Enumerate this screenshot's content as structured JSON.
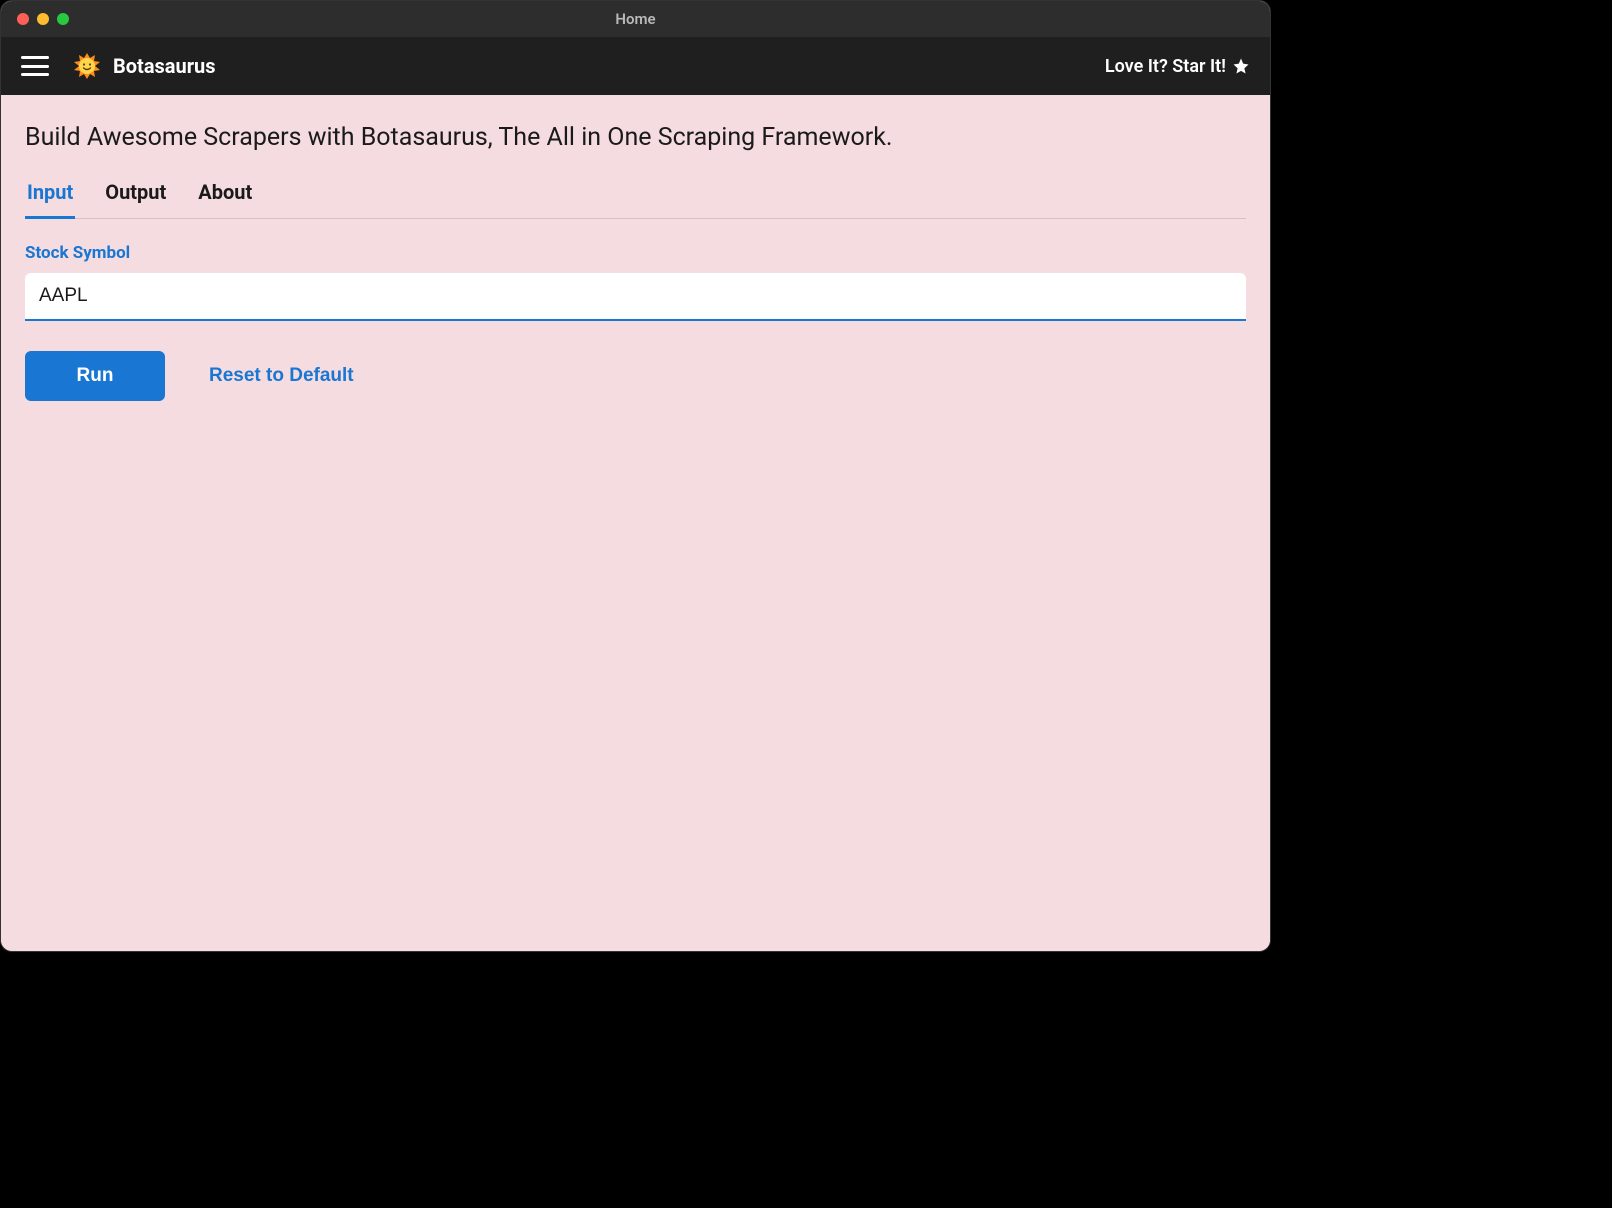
{
  "window": {
    "title": "Home"
  },
  "appbar": {
    "brand": "Botasaurus",
    "star_label": "Love It? Star It!"
  },
  "main": {
    "headline": "Build Awesome Scrapers with Botasaurus, The All in One Scraping Framework.",
    "tabs": [
      {
        "label": "Input",
        "active": true
      },
      {
        "label": "Output",
        "active": false
      },
      {
        "label": "About",
        "active": false
      }
    ],
    "form": {
      "stock_symbol_label": "Stock Symbol",
      "stock_symbol_value": "AAPL"
    },
    "actions": {
      "run_label": "Run",
      "reset_label": "Reset to Default"
    }
  },
  "colors": {
    "accent": "#1976d2",
    "app_bg": "#f5dce0",
    "appbar_bg": "#1f1f1f",
    "titlebar_bg": "#2d2d2d"
  }
}
